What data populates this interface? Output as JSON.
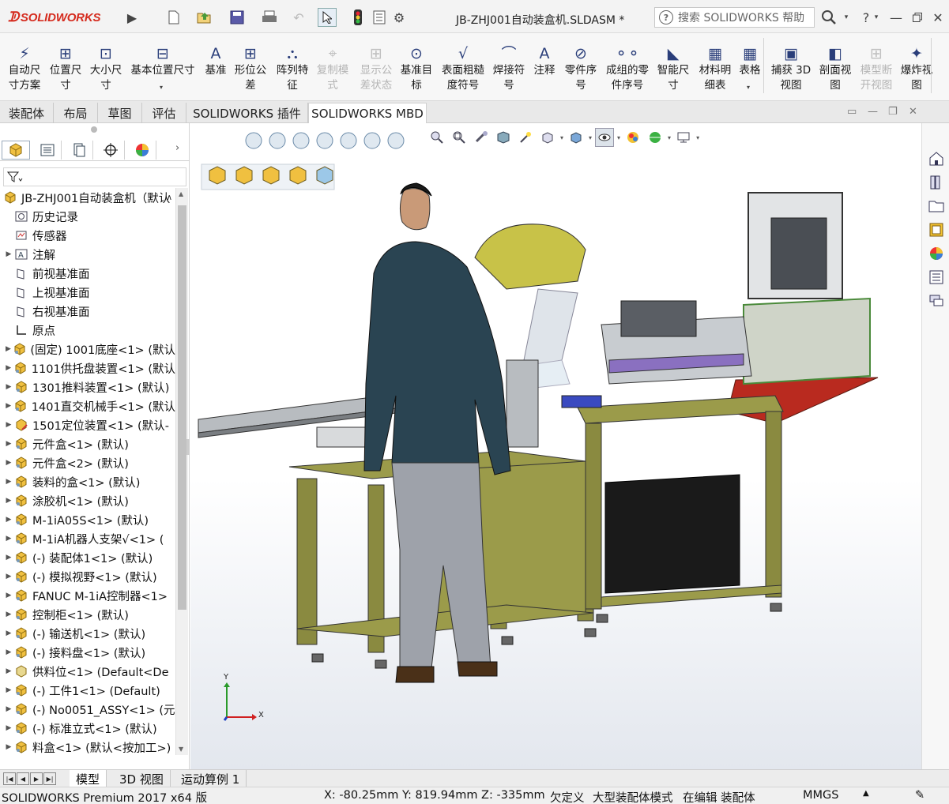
{
  "app": {
    "brand": "SOLIDWORKS",
    "doc_title": "JB-ZHJ001自动装盒机.SLDASM *",
    "search_placeholder": "搜索 SOLIDWORKS 帮助",
    "help": "?"
  },
  "toolbar": [
    {
      "label": "自动尺\n寸方案",
      "icon": "auto-dimension-scheme-icon",
      "enabled": true
    },
    {
      "label": "位置尺\n寸",
      "icon": "location-dimension-icon",
      "enabled": true
    },
    {
      "label": "大小尺\n寸",
      "icon": "size-dimension-icon",
      "enabled": true
    },
    {
      "label": "基本位置尺寸",
      "icon": "basic-location-dimension-icon",
      "enabled": true
    },
    {
      "label": "基准",
      "icon": "datum-icon",
      "enabled": true
    },
    {
      "label": "形位公\n差",
      "icon": "geometric-tolerance-icon",
      "enabled": true
    },
    {
      "label": "阵列特\n征",
      "icon": "pattern-feature-icon",
      "enabled": true
    },
    {
      "label": "复制模\n式",
      "icon": "copy-scheme-icon",
      "enabled": false
    },
    {
      "label": "显示公\n差状态",
      "icon": "show-tolerance-status-icon",
      "enabled": false
    },
    {
      "label": "基准目\n标",
      "icon": "datum-target-icon",
      "enabled": true
    },
    {
      "label": "表面粗糙\n度符号",
      "icon": "surface-finish-icon",
      "enabled": true
    },
    {
      "label": "焊接符\n号",
      "icon": "weld-symbol-icon",
      "enabled": true
    },
    {
      "label": "注释",
      "icon": "note-icon",
      "enabled": true
    },
    {
      "label": "零件序\n号",
      "icon": "balloon-icon",
      "enabled": true
    },
    {
      "label": "成组的零\n件序号",
      "icon": "stacked-balloon-icon",
      "enabled": true
    },
    {
      "label": "智能尺\n寸",
      "icon": "smart-dimension-icon",
      "enabled": true
    },
    {
      "label": "材料明\n细表",
      "icon": "bom-icon",
      "enabled": true
    },
    {
      "label": "表格",
      "icon": "table-icon",
      "enabled": true
    },
    {
      "label": "捕获 3D\n视图",
      "icon": "capture-3d-view-icon",
      "enabled": true
    },
    {
      "label": "剖面视\n图",
      "icon": "section-view-icon",
      "enabled": true
    },
    {
      "label": "模型断\n开视图",
      "icon": "model-break-view-icon",
      "enabled": false
    },
    {
      "label": "爆炸视\n图",
      "icon": "exploded-view-icon",
      "enabled": true
    }
  ],
  "tabs": [
    "装配体",
    "布局",
    "草图",
    "评估",
    "SOLIDWORKS 插件",
    "SOLIDWORKS MBD"
  ],
  "active_tab": "SOLIDWORKS MBD",
  "tree": {
    "root": "JB-ZHJ001自动装盒机（默认",
    "items": [
      {
        "label": "历史记录",
        "icon": "history-icon",
        "expandable": false
      },
      {
        "label": "传感器",
        "icon": "sensor-icon",
        "expandable": false
      },
      {
        "label": "注解",
        "icon": "annotation-icon",
        "expandable": true
      },
      {
        "label": "前视基准面",
        "icon": "plane-icon",
        "expandable": false
      },
      {
        "label": "上视基准面",
        "icon": "plane-icon",
        "expandable": false
      },
      {
        "label": "右视基准面",
        "icon": "plane-icon",
        "expandable": false
      },
      {
        "label": "原点",
        "icon": "origin-icon",
        "expandable": false
      },
      {
        "label": "(固定) 1001底座<1> (默认",
        "icon": "subassembly-icon",
        "expandable": true
      },
      {
        "label": "1101供托盘装置<1> (默认",
        "icon": "subassembly-icon",
        "expandable": true
      },
      {
        "label": "1301推料装置<1> (默认)",
        "icon": "subassembly-icon",
        "expandable": true
      },
      {
        "label": "1401直交机械手<1> (默认",
        "icon": "subassembly-icon",
        "expandable": true
      },
      {
        "label": "1501定位装置<1> (默认-",
        "icon": "subassembly-edit-icon",
        "expandable": true
      },
      {
        "label": "元件盒<1> (默认)",
        "icon": "subassembly-icon",
        "expandable": true
      },
      {
        "label": "元件盒<2> (默认)",
        "icon": "subassembly-icon",
        "expandable": true
      },
      {
        "label": "装料的盒<1> (默认)",
        "icon": "subassembly-icon",
        "expandable": true
      },
      {
        "label": "涂胶机<1> (默认)",
        "icon": "subassembly-icon",
        "expandable": true
      },
      {
        "label": "M-1iA05S<1> (默认)",
        "icon": "subassembly-icon",
        "expandable": true
      },
      {
        "label": "M-1iA机器人支架√<1> (",
        "icon": "subassembly-icon",
        "expandable": true
      },
      {
        "label": "(-) 装配体1<1> (默认)",
        "icon": "subassembly-icon",
        "expandable": true
      },
      {
        "label": "(-) 模拟视野<1> (默认)",
        "icon": "subassembly-icon",
        "expandable": true
      },
      {
        "label": "FANUC M-1iA控制器<1>",
        "icon": "subassembly-icon",
        "expandable": true
      },
      {
        "label": "控制柜<1> (默认)",
        "icon": "subassembly-icon",
        "expandable": true
      },
      {
        "label": "(-) 输送机<1> (默认)",
        "icon": "subassembly-icon",
        "expandable": true
      },
      {
        "label": "(-) 接料盘<1> (默认)",
        "icon": "subassembly-icon",
        "expandable": true
      },
      {
        "label": "供料位<1> (Default<De",
        "icon": "part-icon",
        "expandable": true
      },
      {
        "label": "(-) 工件1<1> (Default)",
        "icon": "subassembly-icon",
        "expandable": true
      },
      {
        "label": "(-) No0051_ASSY<1> (元",
        "icon": "subassembly-icon",
        "expandable": true
      },
      {
        "label": "(-) 标准立式<1> (默认)",
        "icon": "subassembly-icon",
        "expandable": true
      },
      {
        "label": "料盒<1> (默认<按加工>)",
        "icon": "subassembly-icon",
        "expandable": true
      }
    ]
  },
  "bottom_tabs": [
    "模型",
    "3D 视图",
    "运动算例 1"
  ],
  "status": {
    "product": "SOLIDWORKS Premium 2017 x64 版",
    "coords": "X: -80.25mm Y: 819.94mm Z: -335mm",
    "defined": "欠定义",
    "mode": "大型装配体模式",
    "editing": "在编辑 装配体",
    "units": "MMGS"
  },
  "triad": {
    "x": "X",
    "y": "Y"
  },
  "colors": {
    "brand": "#d52b1e",
    "machine_frame": "#9b9b4a",
    "frame_green": "#4a8a3a",
    "robot_yellow": "#c8c248",
    "red_chute": "#b92a1f"
  }
}
